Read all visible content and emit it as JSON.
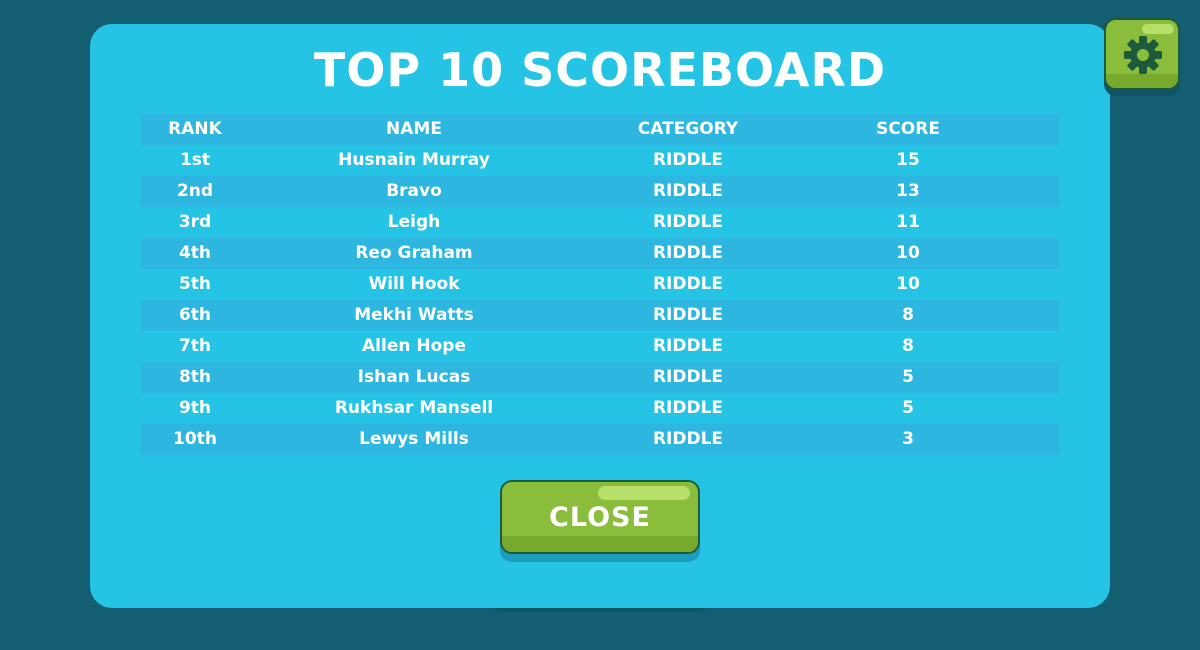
{
  "title": "TOP 10 SCOREBOARD",
  "table": {
    "headers": {
      "rank": "RANK",
      "name": "NAME",
      "category": "CATEGORY",
      "score": "SCORE"
    },
    "rows": [
      {
        "rank": "1st",
        "name": "Husnain Murray",
        "category": "RIDDLE",
        "score": "15"
      },
      {
        "rank": "2nd",
        "name": "Bravo",
        "category": "RIDDLE",
        "score": "13"
      },
      {
        "rank": "3rd",
        "name": "Leigh",
        "category": "RIDDLE",
        "score": "11"
      },
      {
        "rank": "4th",
        "name": "Reo Graham",
        "category": "RIDDLE",
        "score": "10"
      },
      {
        "rank": "5th",
        "name": "Will Hook",
        "category": "RIDDLE",
        "score": "10"
      },
      {
        "rank": "6th",
        "name": "Mekhi Watts",
        "category": "RIDDLE",
        "score": "8"
      },
      {
        "rank": "7th",
        "name": "Allen Hope",
        "category": "RIDDLE",
        "score": "8"
      },
      {
        "rank": "8th",
        "name": "Ishan Lucas",
        "category": "RIDDLE",
        "score": "5"
      },
      {
        "rank": "9th",
        "name": "Rukhsar Mansell",
        "category": "RIDDLE",
        "score": "5"
      },
      {
        "rank": "10th",
        "name": "Lewys Mills",
        "category": "RIDDLE",
        "score": "3"
      }
    ]
  },
  "close_button": {
    "label": "CLOSE"
  },
  "settings_button": {
    "icon": "gear-icon"
  },
  "colors": {
    "background": "#135e70",
    "panel": "#25c4e4",
    "row_stripe": "#2cb6e0",
    "button_green": "#8bbd3c",
    "gear_dark": "#1f5b3a",
    "text": "#ffffff"
  }
}
